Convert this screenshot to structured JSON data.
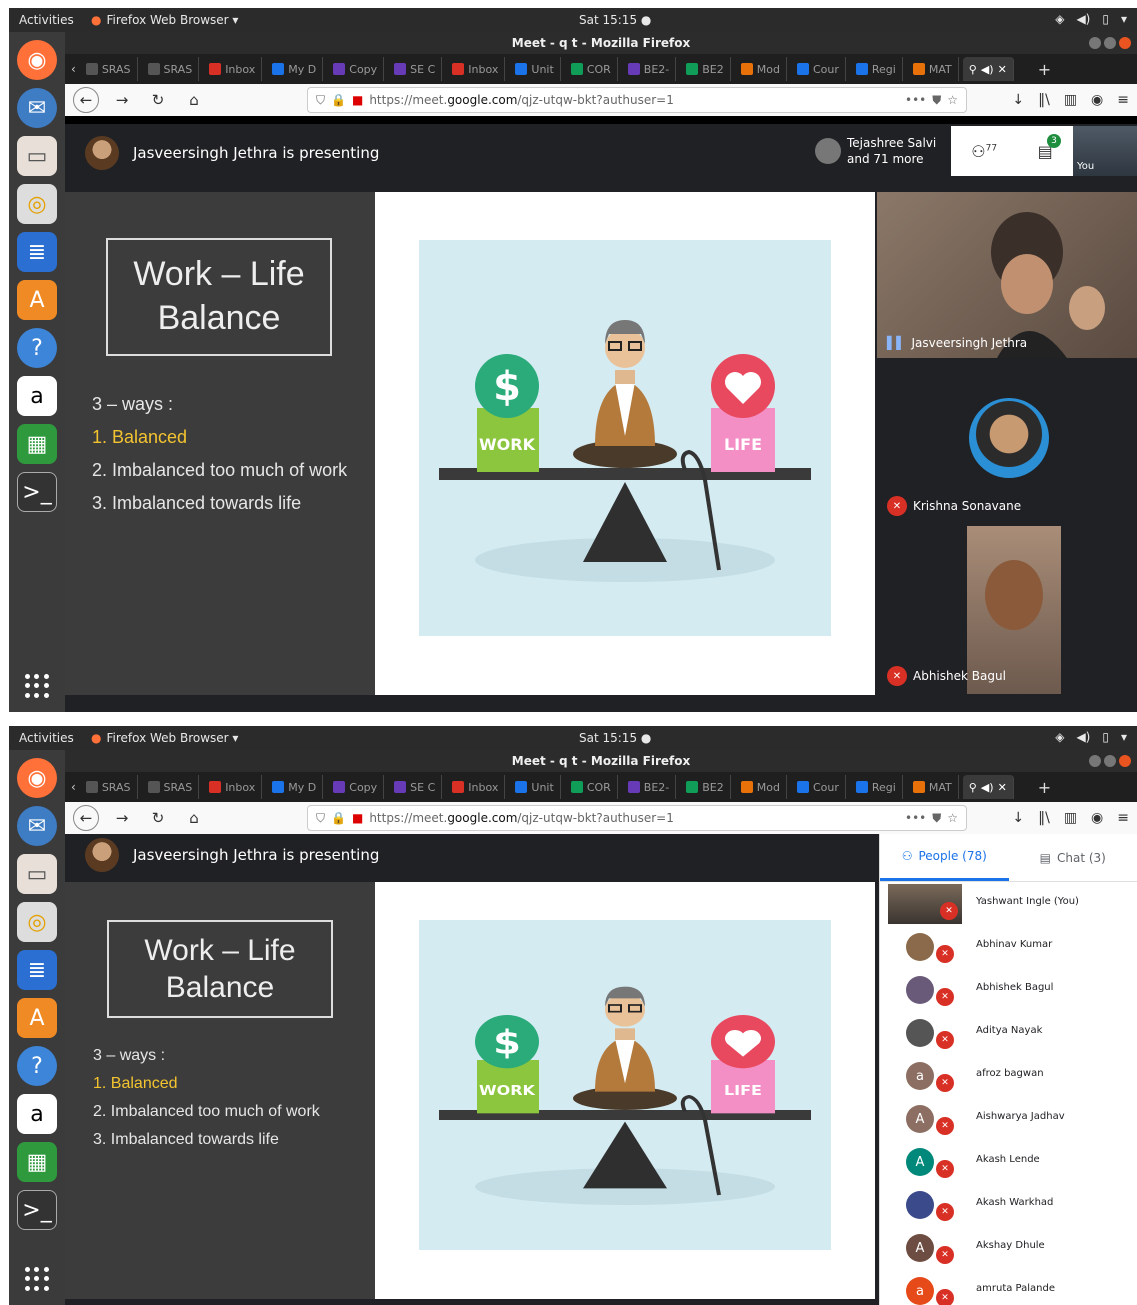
{
  "topbar": {
    "activities": "Activities",
    "app_menu": "Firefox Web Browser ▾",
    "clock": "Sat 15:15 ●"
  },
  "window": {
    "title": "Meet - q t - Mozilla Firefox"
  },
  "tabs": [
    {
      "label": "SRAS",
      "color": "#555"
    },
    {
      "label": "SRAS",
      "color": "#555"
    },
    {
      "label": "Inbox",
      "color": "#d93025"
    },
    {
      "label": "My D",
      "color": "#1a73e8"
    },
    {
      "label": "Copy",
      "color": "#673ab7"
    },
    {
      "label": "SE C",
      "color": "#673ab7"
    },
    {
      "label": "Inbox",
      "color": "#d93025"
    },
    {
      "label": "Unit",
      "color": "#1a73e8"
    },
    {
      "label": "COR",
      "color": "#0f9d58"
    },
    {
      "label": "BE2-",
      "color": "#673ab7"
    },
    {
      "label": "BE2",
      "color": "#0f9d58"
    },
    {
      "label": "Mod",
      "color": "#e8710a"
    },
    {
      "label": "Cour",
      "color": "#1a73e8"
    },
    {
      "label": "Regi",
      "color": "#1a73e8"
    },
    {
      "label": "MAT",
      "color": "#e8710a"
    }
  ],
  "url": {
    "prefix": "https://meet.",
    "domain": "google.com",
    "path": "/qjz-utqw-bkt?authuser=1"
  },
  "meet": {
    "presenting": "Jasveersingh Jethra is presenting",
    "others_line1": "Tejashree Salvi",
    "others_line2": "and 71 more",
    "people_count": "77",
    "chat_badge": "3",
    "self_label": "You"
  },
  "slide": {
    "title_line1": "Work – Life",
    "title_line2": "Balance",
    "ways": "3 – ways :",
    "item1": "1. Balanced",
    "item2": "2. Imbalanced too much of work",
    "item3": "3. Imbalanced towards life",
    "work_label": "WORK",
    "life_label": "LIFE"
  },
  "tiles": [
    {
      "name": "Jasveersingh Jethra"
    },
    {
      "name": "Krishna Sonavane"
    },
    {
      "name": "Abhishek Bagul"
    }
  ],
  "panel": {
    "people_tab": "People (78)",
    "chat_tab": "Chat (3)",
    "participants": [
      {
        "name": "Yashwant Ingle (You)",
        "initial": "",
        "color": "#5a4a40"
      },
      {
        "name": "Abhinav Kumar",
        "initial": "",
        "color": "#8a6a4a"
      },
      {
        "name": "Abhishek Bagul",
        "initial": "",
        "color": "#6a5a7a"
      },
      {
        "name": "Aditya Nayak",
        "initial": "",
        "color": "#555"
      },
      {
        "name": "afroz bagwan",
        "initial": "a",
        "color": "#8d6e63"
      },
      {
        "name": "Aishwarya Jadhav",
        "initial": "A",
        "color": "#8d6e63"
      },
      {
        "name": "Akash Lende",
        "initial": "A",
        "color": "#00897b"
      },
      {
        "name": "Akash Warkhad",
        "initial": "",
        "color": "#3a4a8a"
      },
      {
        "name": "Akshay Dhule",
        "initial": "A",
        "color": "#6d4c41"
      },
      {
        "name": "amruta Palande",
        "initial": "a",
        "color": "#e64a19"
      }
    ]
  }
}
